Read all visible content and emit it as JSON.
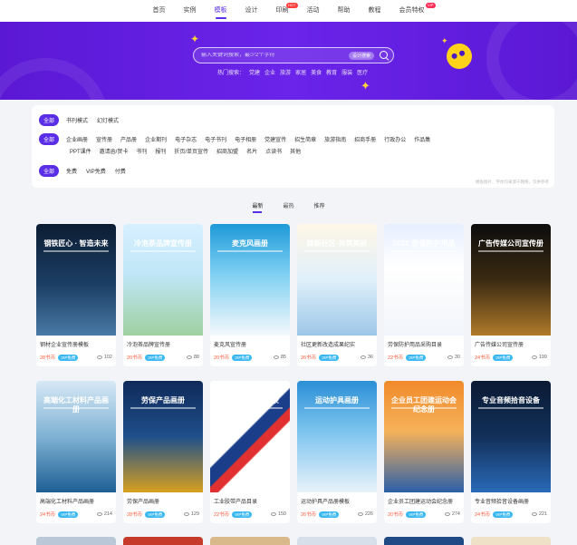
{
  "nav": {
    "items": [
      "首页",
      "实例",
      "模板",
      "设计",
      "印刷",
      "活动",
      "帮助",
      "教程",
      "会员特权"
    ],
    "active_index": 2,
    "print_badge": "HOT",
    "vip_badge": "VIP"
  },
  "banner": {
    "search_placeholder": "输入关键词搜索，最少2个字符",
    "search_tag": "设计搜索",
    "hot_label": "热门搜索：",
    "hot_terms": [
      "党建",
      "企业",
      "旅游",
      "家居",
      "美食",
      "教育",
      "服装",
      "医疗"
    ]
  },
  "filters": {
    "row1": {
      "all": "全部",
      "options": [
        "书刊模式",
        "幻灯模式"
      ]
    },
    "row2": {
      "all": "全部",
      "options": [
        "企业画册",
        "宣传册",
        "产品册",
        "企业期刊",
        "电子杂志",
        "电子书刊",
        "电子相册",
        "党建宣传",
        "招生简章",
        "旅游指南",
        "招商手册",
        "行政办公",
        "作品集"
      ]
    },
    "row2b": {
      "options": [
        "PPT课件",
        "邀请函/贺卡",
        "书刊",
        "报刊",
        "折页/单页宣传",
        "招商加盟",
        "名片",
        "点读书",
        "其他"
      ]
    },
    "row3": {
      "all": "全部",
      "options": [
        "免费",
        "VIP免费",
        "付费"
      ]
    },
    "note": "模板图片、字体均来源于网络，仅供参考"
  },
  "sort": {
    "tabs": [
      "最新",
      "最热",
      "推荐"
    ],
    "active_index": 0
  },
  "colors": {
    "accent": "#5a2ee6",
    "price": "#ff5a3c",
    "vip": "#39b8f2"
  },
  "cards": [
    {
      "thumb_text": "钢铁匠心 · 智造未来",
      "title": "钢材企业宣传册模板",
      "price": "28书币",
      "vip": "VIP免费",
      "views": "102",
      "bg": "linear-gradient(180deg,#0c1d33 0%,#1c3f66 55%,#4a7aa6 100%)"
    },
    {
      "thumb_text": "冷泡茶品牌宣传册",
      "title": "冷泡茶品牌宣传册",
      "price": "20书币",
      "vip": "VIP免费",
      "views": "88",
      "bg": "linear-gradient(180deg,#d7f0ff 0%,#bfe6f7 45%,#9fd0a0 100%)"
    },
    {
      "thumb_text": "麦克风画册",
      "title": "麦克风宣传册",
      "price": "20书币",
      "vip": "VIP免费",
      "views": "85",
      "bg": "linear-gradient(180deg,#1e9ad8 0%,#7fd0f2 45%,#f4f8fb 100%)"
    },
    {
      "thumb_text": "焕新社区·共筑美好",
      "title": "社区更新改造成果纪实",
      "price": "26书币",
      "vip": "VIP免费",
      "views": "36",
      "bg": "linear-gradient(180deg,#fff6e6 0%,#dff0fb 50%,#9dc7e8 100%)"
    },
    {
      "thumb_text": "202X 劳保防护用品",
      "title": "劳保防护用品采购目录",
      "price": "22书币",
      "vip": "VIP免费",
      "views": "30",
      "bg": "linear-gradient(180deg,#e6efff 0%,#ffffff 40%,#f2f5fa 100%)"
    },
    {
      "thumb_text": "广告传媒公司宣传册",
      "title": "广告传媒公司宣传册",
      "price": "24书币",
      "vip": "VIP免费",
      "views": "199",
      "bg": "linear-gradient(180deg,#0d0d0d 0%,#3a2a12 50%,#b07a2a 100%)"
    },
    {
      "thumb_text": "高端化工材料产品画册",
      "title": "高端化工材料产品画册",
      "price": "24书币",
      "vip": "VIP免费",
      "views": "214",
      "bg": "linear-gradient(180deg,#d6e8f5 0%,#7fb2d4 50%,#1e5f94 100%)"
    },
    {
      "thumb_text": "劳保产品画册",
      "title": "劳保产品画册",
      "price": "28书币",
      "vip": "VIP免费",
      "views": "129",
      "bg": "linear-gradient(180deg,#0f2a5a 0%,#1f4f8a 50%,#d8a020 100%)"
    },
    {
      "thumb_text": "工业胶带产品目录",
      "title": "工业胶带产品目录",
      "price": "22书币",
      "vip": "VIP免费",
      "views": "150",
      "bg": "linear-gradient(135deg,#ffffff 0%,#ffffff 45%,#1a3e8a 46%,#1a3e8a 55%,#e03030 56%,#e03030 62%,#ffffff 63%)"
    },
    {
      "thumb_text": "运动护具画册",
      "title": "运动护具产品册模板",
      "price": "26书币",
      "vip": "VIP免费",
      "views": "226",
      "bg": "linear-gradient(180deg,#2c8fd6 0%,#7cc4ee 45%,#e8f2fa 100%)"
    },
    {
      "thumb_text": "企业员工团建运动会纪念册",
      "title": "企业员工团建运动会纪念册",
      "price": "20书币",
      "vip": "VIP免费",
      "views": "274",
      "bg": "linear-gradient(180deg,#f08a2a 0%,#f6b25a 45%,#2c5fa8 100%)"
    },
    {
      "thumb_text": "专业音频拾音设备",
      "title": "专业音频拾音设备画册",
      "price": "24书币",
      "vip": "VIP免费",
      "views": "221",
      "bg": "linear-gradient(180deg,#0a1a33 0%,#12305a 50%,#2a6ab8 100%)"
    }
  ]
}
